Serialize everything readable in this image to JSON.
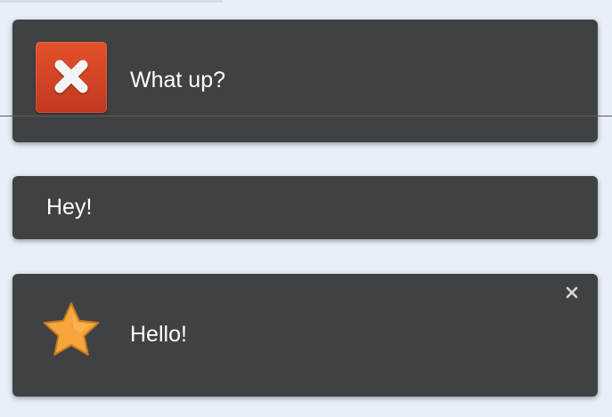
{
  "notifications": [
    {
      "message": "What up?",
      "icon": "error-x-icon",
      "closable": false
    },
    {
      "message": "Hey!",
      "icon": null,
      "closable": false
    },
    {
      "message": "Hello!",
      "icon": "star-icon",
      "closable": true
    }
  ],
  "colors": {
    "page_background": "#e8eff8",
    "card_background": "#404143",
    "text": "#ffffff",
    "error_icon": "#d4442a",
    "star": "#f6a63d"
  }
}
